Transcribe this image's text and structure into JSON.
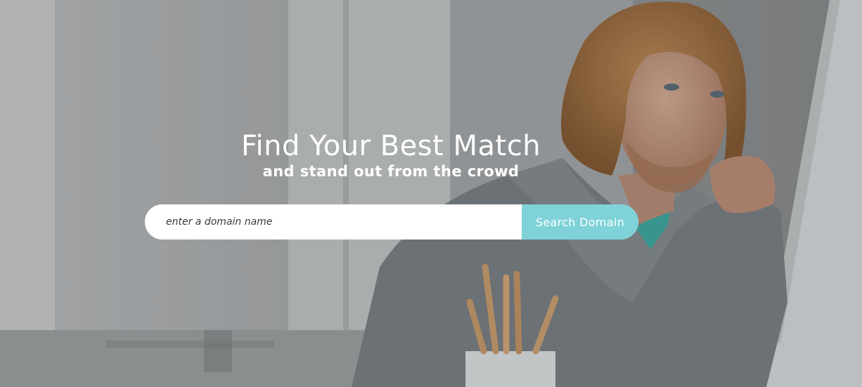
{
  "hero": {
    "title": "Find Your Best Match",
    "subtitle": "and stand out from the crowd"
  },
  "search": {
    "placeholder": "enter a domain name",
    "value": "",
    "button_label": "Search Domain"
  },
  "colors": {
    "button_accent": "#7fd3d8",
    "input_background": "#ffffff",
    "text": "#ffffff"
  },
  "background_image": {
    "subject": "man-in-grey-knit-sweater-at-computer"
  }
}
